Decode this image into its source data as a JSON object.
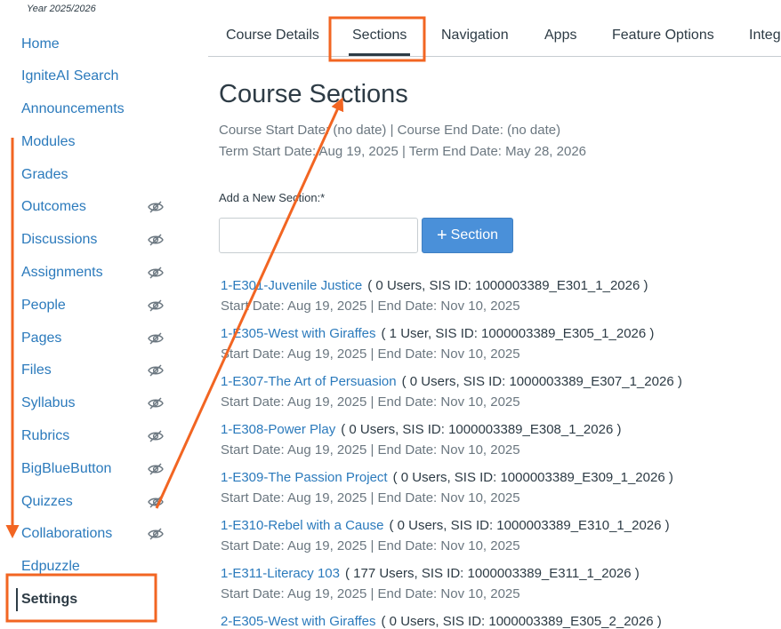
{
  "term": "Year 2025/2026",
  "sidebar": {
    "items": [
      {
        "label": "Home",
        "hidden": false,
        "active": false
      },
      {
        "label": "IgniteAI Search",
        "hidden": false,
        "active": false
      },
      {
        "label": "Announcements",
        "hidden": false,
        "active": false
      },
      {
        "label": "Modules",
        "hidden": false,
        "active": false
      },
      {
        "label": "Grades",
        "hidden": false,
        "active": false
      },
      {
        "label": "Outcomes",
        "hidden": true,
        "active": false
      },
      {
        "label": "Discussions",
        "hidden": true,
        "active": false
      },
      {
        "label": "Assignments",
        "hidden": true,
        "active": false
      },
      {
        "label": "People",
        "hidden": true,
        "active": false
      },
      {
        "label": "Pages",
        "hidden": true,
        "active": false
      },
      {
        "label": "Files",
        "hidden": true,
        "active": false
      },
      {
        "label": "Syllabus",
        "hidden": true,
        "active": false
      },
      {
        "label": "Rubrics",
        "hidden": true,
        "active": false
      },
      {
        "label": "BigBlueButton",
        "hidden": true,
        "active": false
      },
      {
        "label": "Quizzes",
        "hidden": true,
        "active": false
      },
      {
        "label": "Collaborations",
        "hidden": true,
        "active": false
      },
      {
        "label": "Edpuzzle",
        "hidden": false,
        "active": false
      },
      {
        "label": "Settings",
        "hidden": false,
        "active": true
      }
    ]
  },
  "tabs": [
    {
      "label": "Course Details",
      "active": false
    },
    {
      "label": "Sections",
      "active": true
    },
    {
      "label": "Navigation",
      "active": false
    },
    {
      "label": "Apps",
      "active": false
    },
    {
      "label": "Feature Options",
      "active": false
    },
    {
      "label": "Integ",
      "active": false
    }
  ],
  "main": {
    "title": "Course Sections",
    "course_dates": "Course Start Date: (no date) | Course End Date: (no date)",
    "term_dates": "Term Start Date: Aug 19, 2025 | Term End Date: May 28, 2026",
    "add_label": "Add a New Section:*",
    "add_input_value": "",
    "add_button_label": "Section",
    "add_button_icon": "plus-icon"
  },
  "sections": [
    {
      "name": "1-E301-Juvenile Justice",
      "meta": "( 0 Users, SIS ID: 1000003389_E301_1_2026 )",
      "dates": "Start Date: Aug 19, 2025 | End Date: Nov 10, 2025"
    },
    {
      "name": "1-E305-West with Giraffes",
      "meta": "( 1 User, SIS ID: 1000003389_E305_1_2026 )",
      "dates": "Start Date: Aug 19, 2025 | End Date: Nov 10, 2025"
    },
    {
      "name": "1-E307-The Art of Persuasion",
      "meta": "( 0 Users, SIS ID: 1000003389_E307_1_2026 )",
      "dates": "Start Date: Aug 19, 2025 | End Date: Nov 10, 2025"
    },
    {
      "name": "1-E308-Power Play",
      "meta": "( 0 Users, SIS ID: 1000003389_E308_1_2026 )",
      "dates": "Start Date: Aug 19, 2025 | End Date: Nov 10, 2025"
    },
    {
      "name": "1-E309-The Passion Project",
      "meta": "( 0 Users, SIS ID: 1000003389_E309_1_2026 )",
      "dates": "Start Date: Aug 19, 2025 | End Date: Nov 10, 2025"
    },
    {
      "name": "1-E310-Rebel with a Cause",
      "meta": "( 0 Users, SIS ID: 1000003389_E310_1_2026 )",
      "dates": "Start Date: Aug 19, 2025 | End Date: Nov 10, 2025"
    },
    {
      "name": "1-E311-Literacy 103",
      "meta": "( 177 Users, SIS ID: 1000003389_E311_1_2026 )",
      "dates": "Start Date: Aug 19, 2025 | End Date: Nov 10, 2025"
    },
    {
      "name": "2-E305-West with Giraffes",
      "meta": "( 0 Users, SIS ID: 1000003389_E305_2_2026 )",
      "dates": ""
    }
  ],
  "colors": {
    "link": "#2b7abc",
    "text": "#2d3b45",
    "muted": "#6b7780",
    "button": "#4a90d9",
    "annotation": "#f26522"
  }
}
